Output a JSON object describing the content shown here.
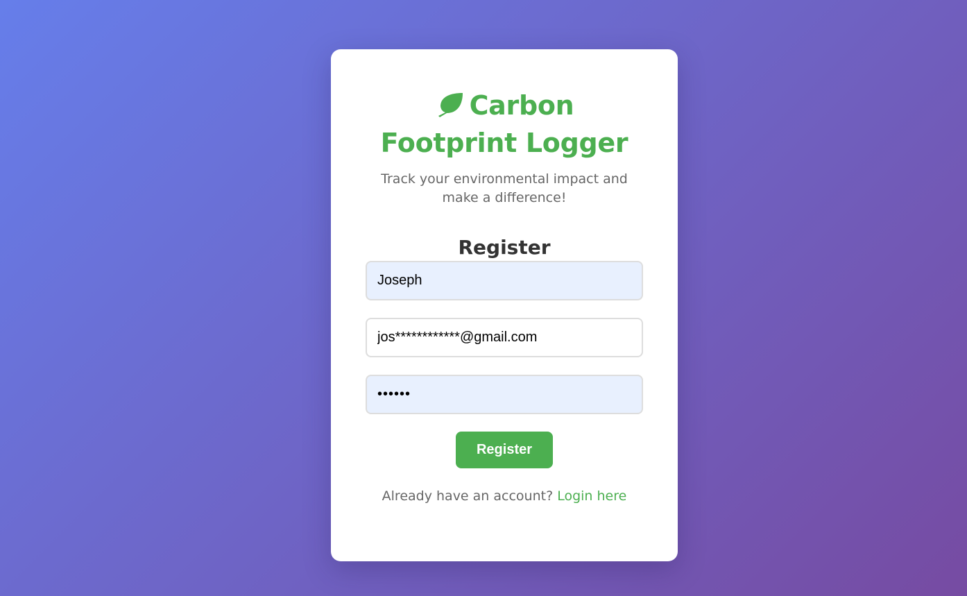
{
  "app": {
    "title": "Carbon Footprint Logger",
    "subtitle": "Track your environmental impact and make a difference!",
    "icon": "leaf-icon",
    "accent_color": "#4caf50"
  },
  "form": {
    "heading": "Register",
    "name_value": "Joseph",
    "email_value": "jos************@gmail.com",
    "password_value": "••••••",
    "submit_label": "Register"
  },
  "footer": {
    "prompt": "Already have an account?",
    "link_label": "Login here"
  }
}
